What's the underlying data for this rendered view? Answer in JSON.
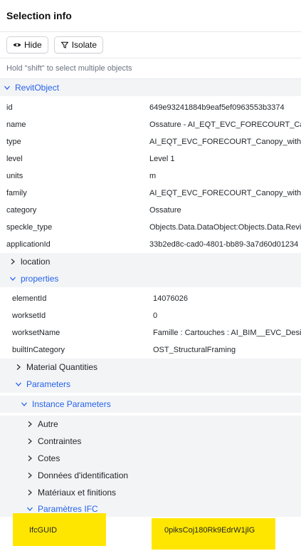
{
  "header": {
    "title": "Selection info"
  },
  "toolbar": {
    "hide_label": "Hide",
    "isolate_label": "Isolate"
  },
  "hint": "Hold \"shift\" to select multiple objects",
  "revit_object": {
    "label": "RevitObject",
    "fields": [
      {
        "key": "id",
        "value": "649e93241884b9eaf5ef0963553b3374"
      },
      {
        "key": "name",
        "value": "Ossature - AI_EQT_EVC_FORECOURT_Canopy_with_Cartouches"
      },
      {
        "key": "type",
        "value": "AI_EQT_EVC_FORECOURT_Canopy_with_Cartouches"
      },
      {
        "key": "level",
        "value": "Level 1"
      },
      {
        "key": "units",
        "value": "m"
      },
      {
        "key": "family",
        "value": "AI_EQT_EVC_FORECOURT_Canopy_with_Cartouches"
      },
      {
        "key": "category",
        "value": "Ossature"
      },
      {
        "key": "speckle_type",
        "value": "Objects.Data.DataObject:Objects.Data.RevitObject"
      },
      {
        "key": "applicationId",
        "value": "33b2ed8c-cad0-4801-bb89-3a7d60d01234"
      }
    ],
    "location_label": "location",
    "properties": {
      "label": "properties",
      "fields": [
        {
          "key": "elementId",
          "value": "14076026"
        },
        {
          "key": "worksetId",
          "value": "0"
        },
        {
          "key": "worksetName",
          "value": "Famille : Cartouches : AI_BIM__EVC_Design"
        },
        {
          "key": "builtInCategory",
          "value": "OST_StructuralFraming"
        }
      ],
      "material_quantities_label": "Material Quantities",
      "parameters": {
        "label": "Parameters",
        "instance": {
          "label": "Instance Parameters",
          "groups": [
            "Autre",
            "Contraintes",
            "Cotes",
            "Données d'identification",
            "Matériaux et finitions"
          ],
          "ifc": {
            "label": "Paramètres IFC",
            "field": {
              "key": "IfcGUID",
              "value": "0piksCoj180Rk9EdrW1jlG"
            }
          }
        }
      }
    }
  },
  "colors": {
    "accent": "#2563eb",
    "highlight": "#ffe600",
    "section_bg": "#f3f4f6"
  }
}
